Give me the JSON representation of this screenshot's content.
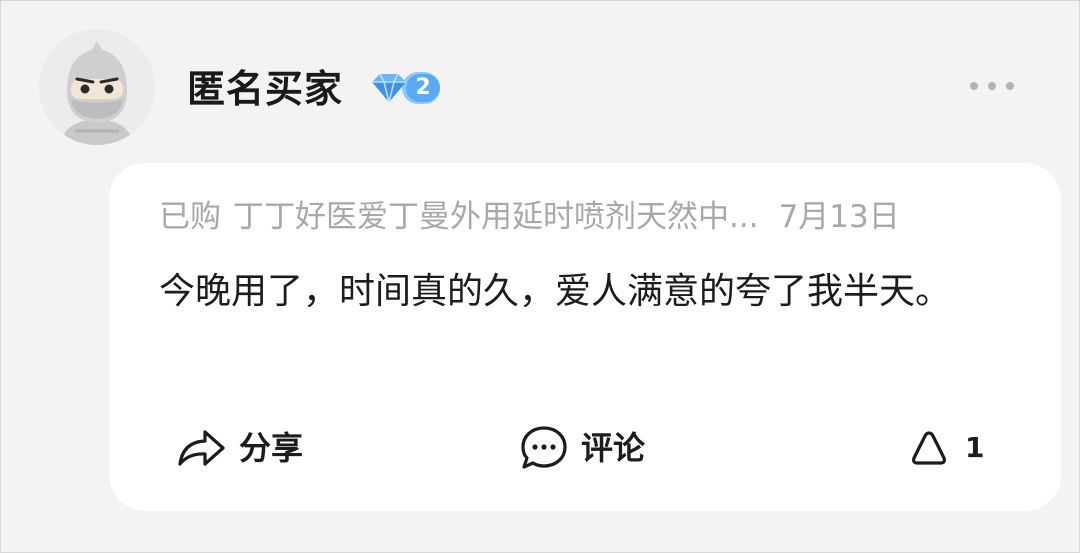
{
  "user": {
    "avatar_icon": "ninja-avatar-icon",
    "name": "匿名买家",
    "vip_icon": "diamond-icon",
    "vip_level": "2"
  },
  "header": {
    "more_icon": "more-dots-icon"
  },
  "review": {
    "purchase_tag": "已购",
    "product_name": "丁丁好医爱丁曼外用延时喷剂天然中...",
    "date": "7月13日",
    "text": "今晚用了，时间真的久，爱人满意的夸了我半天。"
  },
  "actions": {
    "share_label": "分享",
    "share_icon": "share-arrow-icon",
    "comment_label": "评论",
    "comment_icon": "comment-bubble-icon",
    "like_count": "1",
    "like_icon": "like-icon"
  },
  "colors": {
    "page_background": "#f3f3f3",
    "card_background": "#ffffff",
    "muted_text": "#a8a8a8",
    "primary_text": "#1c1c1c",
    "vip_badge": "#5aa9f5"
  }
}
